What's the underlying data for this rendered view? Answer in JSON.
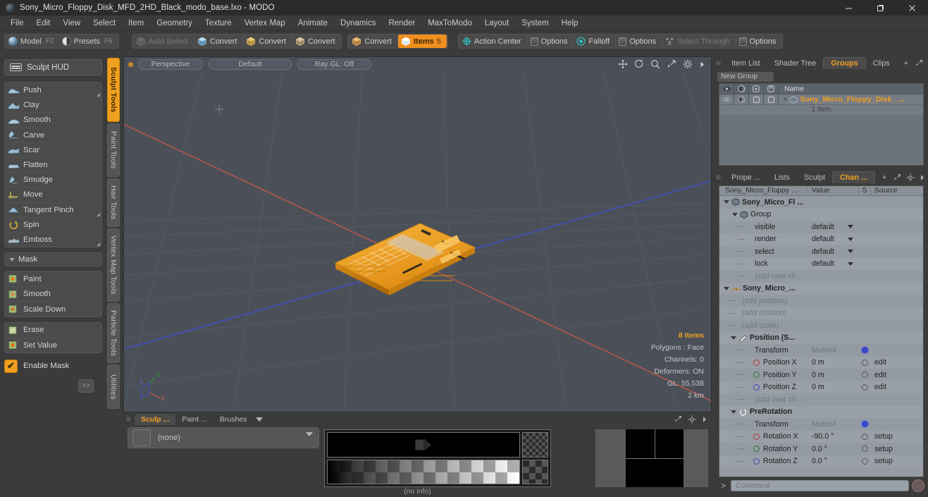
{
  "titlebar": {
    "title": "Sony_Micro_Floppy_Disk_MFD_2HD_Black_modo_base.lxo - MODO",
    "minimize": "—",
    "maximize": "❐",
    "close": "✕"
  },
  "menubar": {
    "items": [
      "File",
      "Edit",
      "View",
      "Select",
      "Item",
      "Geometry",
      "Texture",
      "Vertex Map",
      "Animate",
      "Dynamics",
      "Render",
      "MaxToModo",
      "Layout",
      "System",
      "Help"
    ]
  },
  "modebar": {
    "modes": [
      {
        "label": "Model",
        "key": "F2"
      },
      {
        "label": "Presets",
        "key": "F6"
      }
    ],
    "selection_tools": [
      {
        "label": "Auto Select",
        "key": "",
        "state": "dim"
      },
      {
        "label": "Convert",
        "key": "",
        "state": "normal"
      },
      {
        "label": "Convert",
        "key": "",
        "state": "normal"
      },
      {
        "label": "Convert",
        "key": "",
        "state": "normal"
      }
    ],
    "mode_tools": [
      {
        "label": "Convert",
        "key": "",
        "state": "normal"
      },
      {
        "label": "Items",
        "key": "5",
        "state": "active"
      }
    ],
    "right_tools": [
      {
        "label": "Action Center",
        "icon": "action-center-icon",
        "state": "normal"
      },
      {
        "label": "Options",
        "icon": "options-icon",
        "state": "normal"
      },
      {
        "label": "Falloff",
        "icon": "falloff-icon",
        "state": "normal"
      },
      {
        "label": "Options",
        "icon": "options-icon",
        "state": "normal"
      },
      {
        "label": "Select Through",
        "icon": "select-through-icon",
        "state": "dim"
      },
      {
        "label": "Options",
        "icon": "options-icon",
        "state": "normal"
      }
    ]
  },
  "left_panel": {
    "hud_label": "Sculpt HUD",
    "sculpt_tools": [
      {
        "label": "Push",
        "corner": true
      },
      {
        "label": "Clay",
        "corner": false
      },
      {
        "label": "Smooth",
        "corner": false
      },
      {
        "label": "Carve",
        "corner": false
      },
      {
        "label": "Scar",
        "corner": false
      },
      {
        "label": "Flatten",
        "corner": false
      },
      {
        "label": "Smudge",
        "corner": false
      },
      {
        "label": "Move",
        "corner": false
      },
      {
        "label": "Tangent Pinch",
        "corner": true
      },
      {
        "label": "Spin",
        "corner": false
      },
      {
        "label": "Emboss",
        "corner": true
      }
    ],
    "mask_header": "Mask",
    "mask_tools": [
      {
        "label": "Paint"
      },
      {
        "label": "Smooth"
      },
      {
        "label": "Scale Down"
      }
    ],
    "mask_tools2": [
      {
        "label": "Erase"
      },
      {
        "label": "Set Value"
      }
    ],
    "enable_mask_label": "Enable Mask",
    "enable_mask_checked": true,
    "more_label": ">>"
  },
  "vertical_tabs": [
    {
      "label": "Sculpt Tools",
      "active": true
    },
    {
      "label": "Paint Tools",
      "active": false
    },
    {
      "label": "Hair Tools",
      "active": false
    },
    {
      "label": "Vertex Map Tools",
      "active": false
    },
    {
      "label": "Particle Tools",
      "active": false
    },
    {
      "label": "Utilities",
      "active": false
    }
  ],
  "viewport": {
    "view_name": "Perspective",
    "shading": "Default",
    "raygl": "Ray GL: Off",
    "stats": {
      "items": "8 Items",
      "polygons": "Polygons : Face",
      "channels": "Channels: 0",
      "deformers": "Deformers: ON",
      "gl": "GL: 55,538",
      "scale": "2 km"
    },
    "axis_labels": {
      "x": "X",
      "y": "Y",
      "z": "Z"
    },
    "colors": {
      "background": "#4b5058",
      "model": "#f0a020",
      "x_axis": "#b5564d",
      "z_axis": "#4a5fc0"
    }
  },
  "right_panel": {
    "top_tabs": [
      {
        "label": "Item List",
        "active": false
      },
      {
        "label": "Shader Tree",
        "active": false
      },
      {
        "label": "Groups",
        "active": true
      },
      {
        "label": "Clips",
        "active": false
      }
    ],
    "top_tab_plus": "+",
    "new_group_label": "New Group",
    "list_header": {
      "name": "Name"
    },
    "list_rows": [
      {
        "name": "Sony_Micro_Floppy_Disk_ ...",
        "sub": "1 Item"
      }
    ],
    "bottom_tabs": [
      {
        "label": "Prope ...",
        "active": false
      },
      {
        "label": "Lists",
        "active": false
      },
      {
        "label": "Sculpt",
        "active": false
      },
      {
        "label": "Chan ...",
        "active": true
      }
    ],
    "bottom_tab_plus": "+",
    "channel_header": {
      "name": "Sony_Micro_Floppy ...",
      "value": "Value",
      "s": "S",
      "source": "Source"
    },
    "channel_rows": [
      {
        "indent": 0,
        "twirl": "down",
        "icon": "group-icon",
        "name": "Sony_Micro_Fl ...",
        "value": "",
        "bold": true,
        "s": "",
        "source": ""
      },
      {
        "indent": 1,
        "twirl": "down",
        "icon": "group-icon",
        "name": "Group",
        "value": "",
        "bold": false,
        "s": "",
        "source": ""
      },
      {
        "indent": 2,
        "twirl": "dash",
        "icon": "",
        "name": "visible",
        "value": "default",
        "combo": true,
        "s": "",
        "source": ""
      },
      {
        "indent": 2,
        "twirl": "dash",
        "icon": "",
        "name": "render",
        "value": "default",
        "combo": true,
        "s": "",
        "source": ""
      },
      {
        "indent": 2,
        "twirl": "dash",
        "icon": "",
        "name": "select",
        "value": "default",
        "combo": true,
        "s": "",
        "source": ""
      },
      {
        "indent": 2,
        "twirl": "dash",
        "icon": "",
        "name": "lock",
        "value": "default",
        "combo": true,
        "s": "",
        "source": ""
      },
      {
        "indent": 2,
        "twirl": "dash",
        "icon": "",
        "name": "(add user ch ...",
        "value": "",
        "dim": true,
        "s": "",
        "source": ""
      },
      {
        "indent": 0,
        "twirl": "down",
        "icon": "mesh-icon",
        "name": "Sony_Micro_...",
        "value": "",
        "bold": true,
        "s": "",
        "source": ""
      },
      {
        "indent": 1,
        "twirl": "arrow",
        "icon": "",
        "name": "(add position)",
        "value": "",
        "dim": true,
        "s": "",
        "source": ""
      },
      {
        "indent": 1,
        "twirl": "arrow",
        "icon": "",
        "name": "(add rotation)",
        "value": "",
        "dim": true,
        "s": "",
        "source": ""
      },
      {
        "indent": 1,
        "twirl": "arrow",
        "icon": "",
        "name": "(add scale)",
        "value": "",
        "dim": true,
        "s": "",
        "source": ""
      },
      {
        "indent": 1,
        "twirl": "down",
        "icon": "position-icon",
        "name": "Position (S...",
        "value": "",
        "bold": true,
        "s": "",
        "source": ""
      },
      {
        "indent": 2,
        "twirl": "dash",
        "icon": "",
        "name": "Transform",
        "value": "Matrix4",
        "valuedim": true,
        "s": "gear",
        "source": ""
      },
      {
        "indent": 2,
        "twirl": "dash",
        "icon": "ring-red",
        "name": "Position X",
        "value": "0 m",
        "s": "ring",
        "source": "edit"
      },
      {
        "indent": 2,
        "twirl": "dash",
        "icon": "ring-green",
        "name": "Position Y",
        "value": "0 m",
        "s": "ring",
        "source": "edit"
      },
      {
        "indent": 2,
        "twirl": "dash",
        "icon": "ring-blue",
        "name": "Position Z",
        "value": "0 m",
        "s": "ring",
        "source": "edit"
      },
      {
        "indent": 2,
        "twirl": "dash",
        "icon": "",
        "name": "(add user ch ...",
        "value": "",
        "dim": true,
        "s": "",
        "source": ""
      },
      {
        "indent": 1,
        "twirl": "down",
        "icon": "prerotation-icon",
        "name": "PreRotation",
        "value": "",
        "bold": true,
        "s": "",
        "source": ""
      },
      {
        "indent": 2,
        "twirl": "dash",
        "icon": "",
        "name": "Transform",
        "value": "Matrix4",
        "valuedim": true,
        "s": "gear",
        "source": ""
      },
      {
        "indent": 2,
        "twirl": "dash",
        "icon": "ring-red",
        "name": "Rotation X",
        "value": "-90.0 °",
        "s": "ring",
        "source": "setup"
      },
      {
        "indent": 2,
        "twirl": "dash",
        "icon": "ring-green",
        "name": "Rotation Y",
        "value": "0.0 °",
        "s": "ring",
        "source": "setup"
      },
      {
        "indent": 2,
        "twirl": "dash",
        "icon": "ring-blue",
        "name": "Rotation Z",
        "value": "0.0 °",
        "s": "ring",
        "source": "setup"
      }
    ],
    "command": {
      "prompt": ">",
      "placeholder": "Command",
      "value": ""
    }
  },
  "bottom_panel": {
    "tabs": [
      {
        "label": "Sculp ...",
        "active": true
      },
      {
        "label": "Paint ...",
        "active": false
      },
      {
        "label": "Brushes",
        "active": false
      }
    ],
    "brush_value": "(none)",
    "status": "(no info)"
  }
}
